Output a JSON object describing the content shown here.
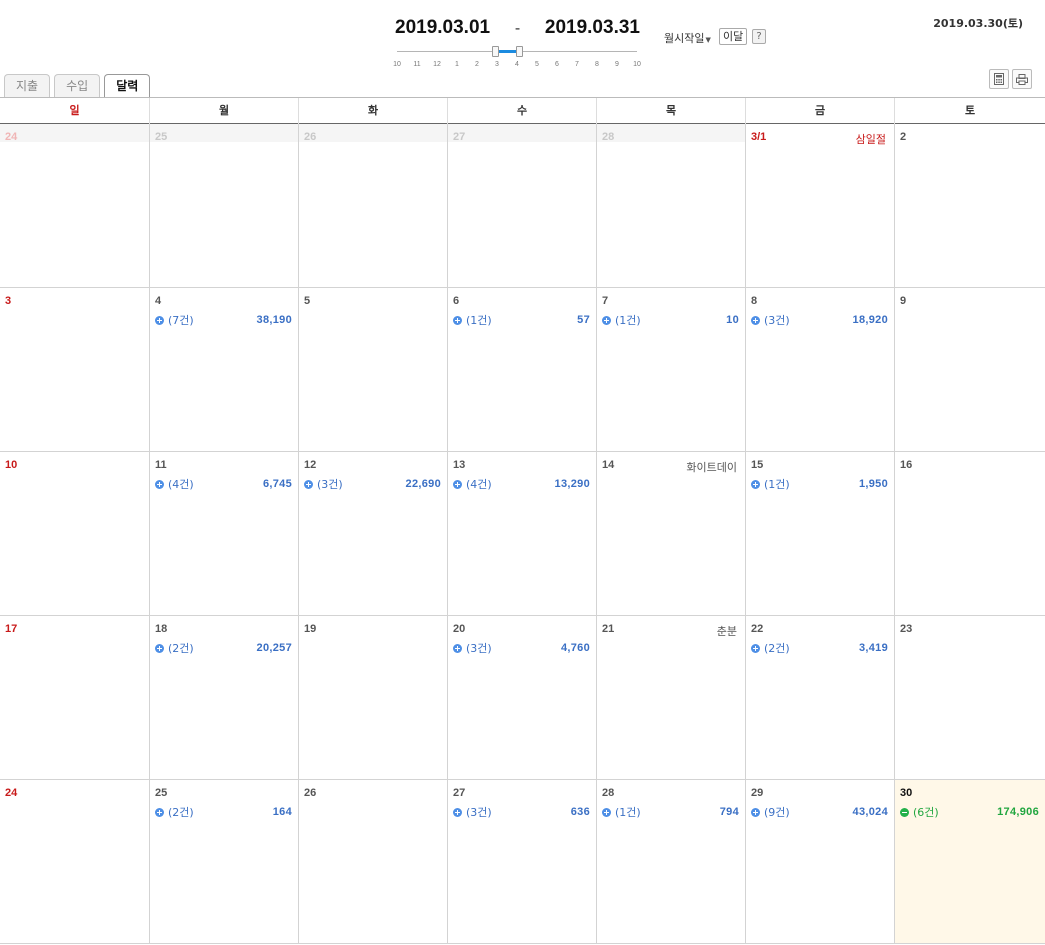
{
  "header": {
    "start_date": "2019.03.01",
    "range_sep": "-",
    "end_date": "2019.03.31",
    "slider_ticks": [
      "10",
      "11",
      "12",
      "1",
      "2",
      "3",
      "4",
      "5",
      "6",
      "7",
      "8",
      "9",
      "10"
    ],
    "month_start_label": "월시작일",
    "this_month_label": "이달",
    "help_label": "?",
    "today_label": "2019.03.30(토)"
  },
  "tabs": [
    {
      "label": "지출",
      "active": false
    },
    {
      "label": "수입",
      "active": false
    },
    {
      "label": "달력",
      "active": true
    }
  ],
  "tools": [
    "calculator-icon",
    "print-icon"
  ],
  "weekdays": [
    "일",
    "월",
    "화",
    "수",
    "목",
    "금",
    "토"
  ],
  "colors": {
    "sunday": "#c81a1a",
    "expense": "#3a6fc4",
    "income": "#21a63f",
    "today_bg": "#fff8e8"
  },
  "weeks": [
    [
      {
        "num": "24",
        "other": true
      },
      {
        "num": "25",
        "other": true
      },
      {
        "num": "26",
        "other": true
      },
      {
        "num": "27",
        "other": true
      },
      {
        "num": "28",
        "other": true
      },
      {
        "num": "3/1",
        "holiday": "삼일절"
      },
      {
        "num": "2"
      }
    ],
    [
      {
        "num": "3"
      },
      {
        "num": "4",
        "count": "(7건)",
        "amount": "38,190"
      },
      {
        "num": "5"
      },
      {
        "num": "6",
        "count": "(1건)",
        "amount": "57"
      },
      {
        "num": "7",
        "count": "(1건)",
        "amount": "10"
      },
      {
        "num": "8",
        "count": "(3건)",
        "amount": "18,920"
      },
      {
        "num": "9"
      }
    ],
    [
      {
        "num": "10"
      },
      {
        "num": "11",
        "count": "(4건)",
        "amount": "6,745"
      },
      {
        "num": "12",
        "count": "(3건)",
        "amount": "22,690"
      },
      {
        "num": "13",
        "count": "(4건)",
        "amount": "13,290"
      },
      {
        "num": "14",
        "memo": "화이트데이"
      },
      {
        "num": "15",
        "count": "(1건)",
        "amount": "1,950"
      },
      {
        "num": "16"
      }
    ],
    [
      {
        "num": "17"
      },
      {
        "num": "18",
        "count": "(2건)",
        "amount": "20,257"
      },
      {
        "num": "19"
      },
      {
        "num": "20",
        "count": "(3건)",
        "amount": "4,760"
      },
      {
        "num": "21",
        "memo": "춘분"
      },
      {
        "num": "22",
        "count": "(2건)",
        "amount": "3,419"
      },
      {
        "num": "23"
      }
    ],
    [
      {
        "num": "24"
      },
      {
        "num": "25",
        "count": "(2건)",
        "amount": "164"
      },
      {
        "num": "26"
      },
      {
        "num": "27",
        "count": "(3건)",
        "amount": "636"
      },
      {
        "num": "28",
        "count": "(1건)",
        "amount": "794"
      },
      {
        "num": "29",
        "count": "(9건)",
        "amount": "43,024"
      },
      {
        "num": "30",
        "count": "(6건)",
        "amount": "174,906",
        "today": true,
        "income": true
      }
    ]
  ]
}
